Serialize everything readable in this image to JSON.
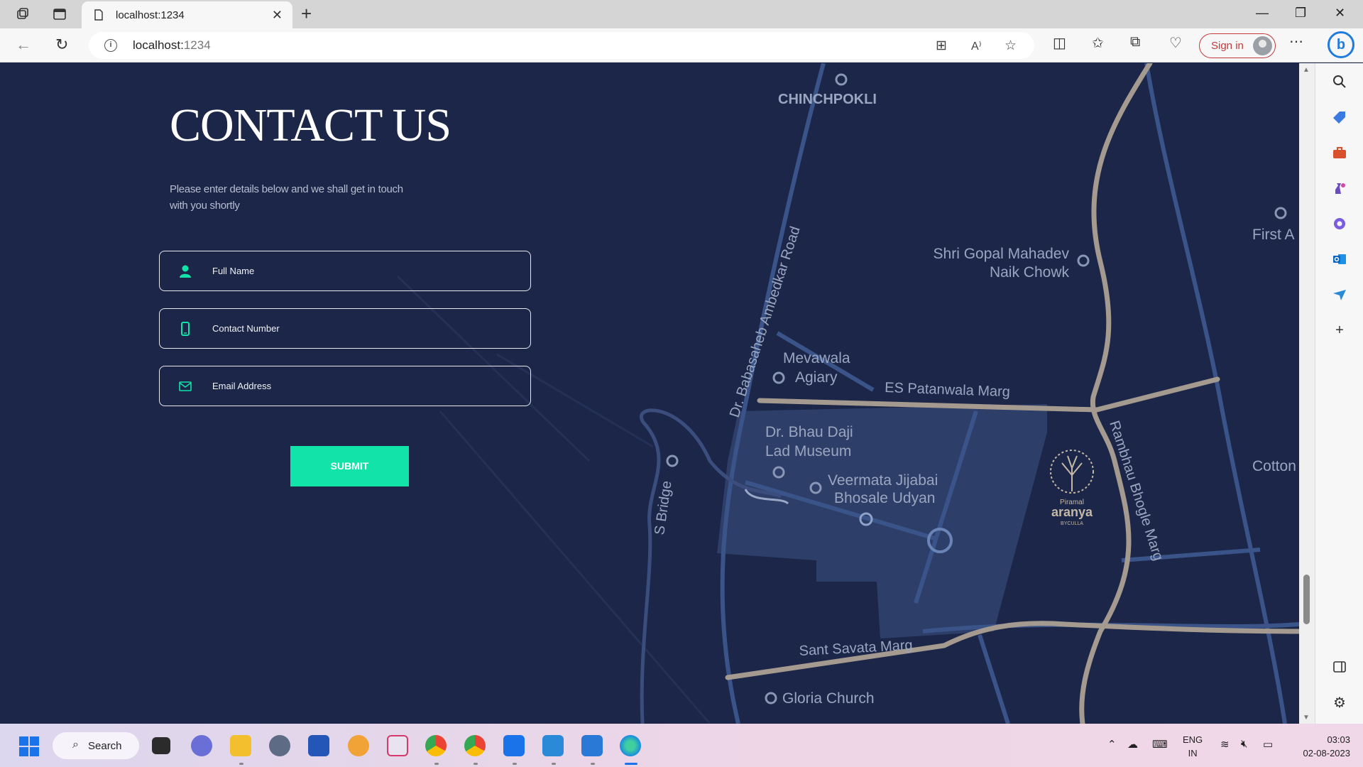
{
  "browser": {
    "tab_title": "localhost:1234",
    "url_host": "localhost:",
    "url_port": "1234",
    "signin_label": "Sign in"
  },
  "page": {
    "heading": "CONTACT US",
    "subtext": "Please enter details below and we shall get in touch with you shortly",
    "fields": [
      {
        "label": "Full Name",
        "icon": "person-icon"
      },
      {
        "label": "Contact Number",
        "icon": "phone-icon"
      },
      {
        "label": "Email Address",
        "icon": "mail-icon"
      }
    ],
    "submit_label": "SUBMIT",
    "accent_color": "#12e3a8"
  },
  "map": {
    "labels": {
      "chinchpokli": "CHINCHPOKLI",
      "ambedkar_road": "Dr. Babasaheb Ambedkar Road",
      "gopal_1": "Shri Gopal Mahadev",
      "gopal_2": "Naik Chowk",
      "first": "First A",
      "mevawala_1": "Mevawala",
      "mevawala_2": "Agiary",
      "patanwala": "ES Patanwala Marg",
      "bhau_1": "Dr. Bhau Daji",
      "bhau_2": "Lad Museum",
      "veermata_1": "Veermata Jijabai",
      "veermata_2": "Bhosale Udyan",
      "s_bridge": "S Bridge",
      "rambhau": "Rambhau Bhogle Marg",
      "cotton": "Cotton",
      "sant_savata": "Sant Savata Marg",
      "gloria": "Gloria Church",
      "brand_small": "Piramal",
      "brand": "aranya",
      "brand_sub": "BYCULLA"
    }
  },
  "taskbar": {
    "search_label": "Search",
    "lang_1": "ENG",
    "lang_2": "IN",
    "time": "03:03",
    "date": "02-08-2023"
  }
}
